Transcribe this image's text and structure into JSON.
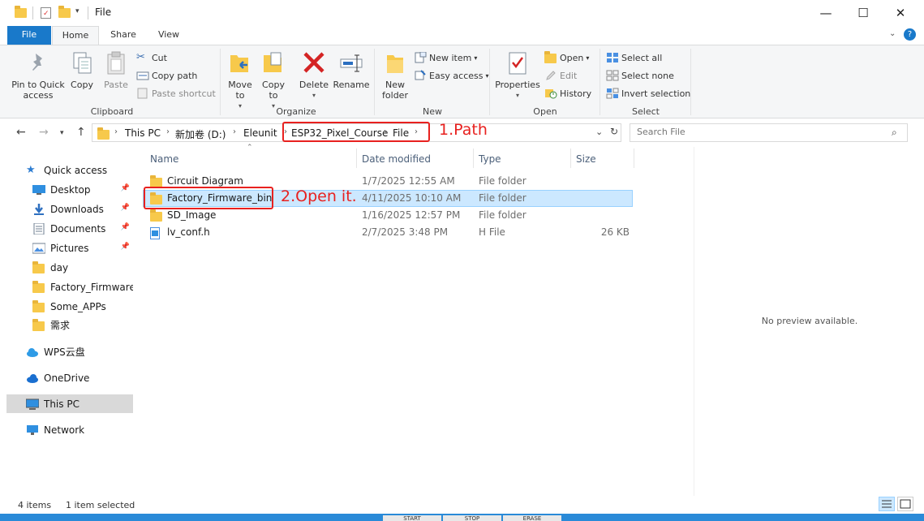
{
  "window": {
    "title": "File",
    "minimize": "—",
    "maximize": "☐",
    "close": "✕"
  },
  "tabs": {
    "file": "File",
    "home": "Home",
    "share": "Share",
    "view": "View"
  },
  "ribbon": {
    "clipboard": {
      "label": "Clipboard",
      "pin": "Pin to Quick access",
      "copy": "Copy",
      "paste": "Paste",
      "cut": "Cut",
      "copy_path": "Copy path",
      "paste_shortcut": "Paste shortcut"
    },
    "organize": {
      "label": "Organize",
      "move_to": "Move to",
      "copy_to": "Copy to",
      "delete": "Delete",
      "rename": "Rename"
    },
    "new": {
      "label": "New",
      "new_folder": "New folder",
      "new_item": "New item",
      "easy_access": "Easy access"
    },
    "open": {
      "label": "Open",
      "properties": "Properties",
      "open": "Open",
      "edit": "Edit",
      "history": "History"
    },
    "select": {
      "label": "Select",
      "select_all": "Select all",
      "select_none": "Select none",
      "invert": "Invert selection"
    }
  },
  "address": {
    "breadcrumbs": [
      "This PC",
      "新加卷 (D:)",
      "Eleunit",
      "ESP32_Pixel_Course",
      "File"
    ]
  },
  "search": {
    "placeholder": "Search File"
  },
  "nav": {
    "quick_access": "Quick access",
    "items": [
      "Desktop",
      "Downloads",
      "Documents",
      "Pictures",
      "day",
      "Factory_Firmware_b",
      "Some_APPs",
      "需求"
    ],
    "wps": "WPS云盘",
    "onedrive": "OneDrive",
    "this_pc": "This PC",
    "network": "Network"
  },
  "columns": {
    "name": "Name",
    "date": "Date modified",
    "type": "Type",
    "size": "Size"
  },
  "files": [
    {
      "name": "Circuit Diagram",
      "date": "1/7/2025 12:55 AM",
      "type": "File folder",
      "size": ""
    },
    {
      "name": "Factory_Firmware_bin",
      "date": "4/11/2025 10:10 AM",
      "type": "File folder",
      "size": ""
    },
    {
      "name": "SD_Image",
      "date": "1/16/2025 12:57 PM",
      "type": "File folder",
      "size": ""
    },
    {
      "name": "lv_conf.h",
      "date": "2/7/2025 3:48 PM",
      "type": "H File",
      "size": "26 KB"
    }
  ],
  "preview": {
    "text": "No preview available."
  },
  "status": {
    "count": "4 items",
    "selected": "1 item selected"
  },
  "taskbar_buttons": [
    "START",
    "STOP",
    "ERASE"
  ],
  "annotations": {
    "path": "1.Path",
    "open": "2.Open it."
  },
  "colors": {
    "accent": "#1979ca",
    "annotation": "#e8211f",
    "selection": "#cce8ff",
    "folder": "#f7c94b"
  }
}
